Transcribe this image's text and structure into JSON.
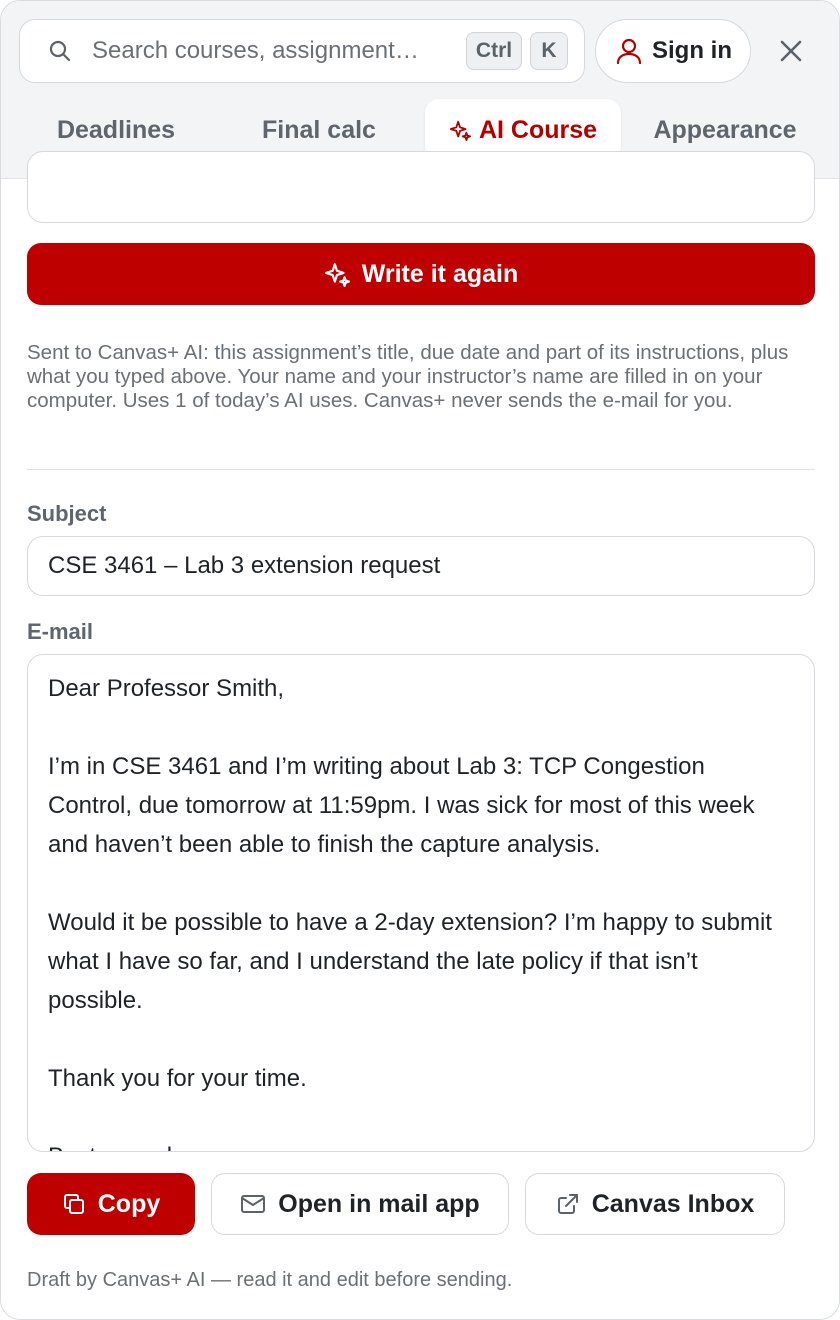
{
  "search": {
    "placeholder": "Search courses, assignment…",
    "shortcut_keys": [
      "Ctrl",
      "K"
    ]
  },
  "header": {
    "sign_in_label": "Sign in",
    "close_icon": "close-icon"
  },
  "tabs": [
    {
      "label": "Deadlines",
      "active": false
    },
    {
      "label": "Final calc",
      "active": false
    },
    {
      "label": "AI Course",
      "active": true,
      "icon": "sparkle-icon"
    },
    {
      "label": "Appearance",
      "active": false
    }
  ],
  "composer": {
    "write_again_label": "Write it again",
    "privacy_note": "Sent to Canvas+ AI: this assignment’s title, due date and part of its instructions, plus what you typed above. Your name and your instructor’s name are filled in on your computer. Uses 1 of today’s AI uses. Canvas+ never sends the e-mail for you.",
    "subject_label": "Subject",
    "subject_value": "CSE 3461 – Lab 3 extension request",
    "email_label": "E-mail",
    "email_body": "Dear Professor Smith,\n\nI’m in CSE 3461 and I’m writing about Lab 3: TCP Congestion Control, due tomorrow at 11:59pm. I was sick for most of this week and haven’t been able to finish the capture analysis.\n\nWould it be possible to have a 2-day extension? I’m happy to submit what I have so far, and I understand the late policy if that isn’t possible.\n\nThank you for your time.\n\nBest regards,"
  },
  "actions": {
    "copy_label": "Copy",
    "mail_app_label": "Open in mail app",
    "canvas_inbox_label": "Canvas Inbox"
  },
  "footer": {
    "disclaimer": "Draft by Canvas+ AI — read it and edit before sending."
  },
  "colors": {
    "accent": "#bf0000",
    "active_tab_text": "#b30000",
    "header_bg": "#f3f4f6",
    "muted_text": "#6b7076"
  }
}
